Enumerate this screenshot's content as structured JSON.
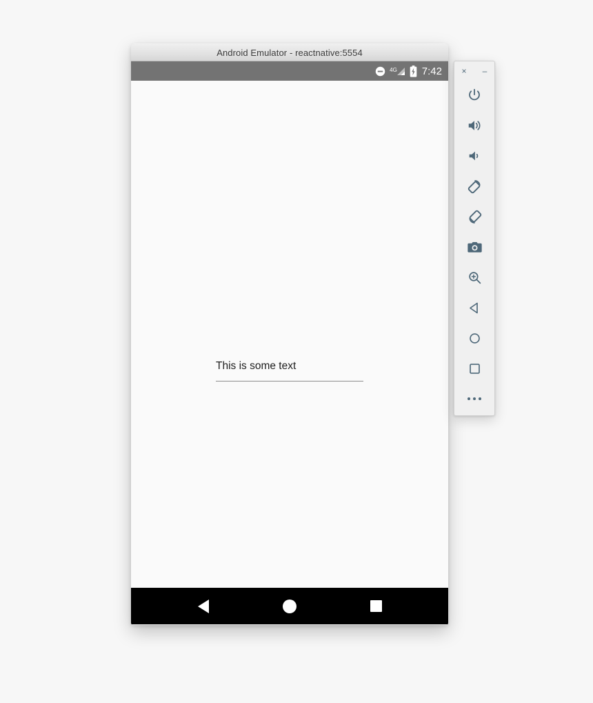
{
  "window": {
    "title": "Android Emulator - reactnative:5554"
  },
  "status_bar": {
    "dnd_icon": "do-not-disturb-icon",
    "network_label": "4G",
    "signal_icon": "signal-bars-icon",
    "battery_icon": "battery-charging-icon",
    "time": "7:42"
  },
  "app": {
    "text_input": {
      "value": "This is some text",
      "placeholder": ""
    }
  },
  "nav_bar": {
    "back_label": "Back",
    "home_label": "Home",
    "recents_label": "Recents"
  },
  "toolbar": {
    "close_label": "×",
    "minimize_label": "–",
    "buttons": [
      {
        "name": "power-button",
        "icon": "power-icon",
        "label": "Power"
      },
      {
        "name": "volume-up-button",
        "icon": "volume-up-icon",
        "label": "Volume Up"
      },
      {
        "name": "volume-down-button",
        "icon": "volume-down-icon",
        "label": "Volume Down"
      },
      {
        "name": "rotate-left-button",
        "icon": "rotate-left-icon",
        "label": "Rotate Left"
      },
      {
        "name": "rotate-right-button",
        "icon": "rotate-right-icon",
        "label": "Rotate Right"
      },
      {
        "name": "screenshot-button",
        "icon": "camera-icon",
        "label": "Take Screenshot"
      },
      {
        "name": "zoom-button",
        "icon": "zoom-in-icon",
        "label": "Enter Zoom Mode"
      },
      {
        "name": "back-button",
        "icon": "back-triangle-icon",
        "label": "Back"
      },
      {
        "name": "home-button",
        "icon": "home-circle-icon",
        "label": "Home"
      },
      {
        "name": "overview-button",
        "icon": "overview-square-icon",
        "label": "Overview"
      },
      {
        "name": "more-button",
        "icon": "ellipsis-icon",
        "label": "More"
      }
    ]
  },
  "colors": {
    "status_bar_bg": "#737373",
    "screen_bg": "#fafafa",
    "nav_bar_bg": "#000000",
    "toolbar_icon": "#4e6879",
    "toolbar_bg": "#f0f0f0",
    "page_bg": "#f7f7f7",
    "input_text": "#1d1d1d",
    "input_underline": "#8d8d8d"
  }
}
